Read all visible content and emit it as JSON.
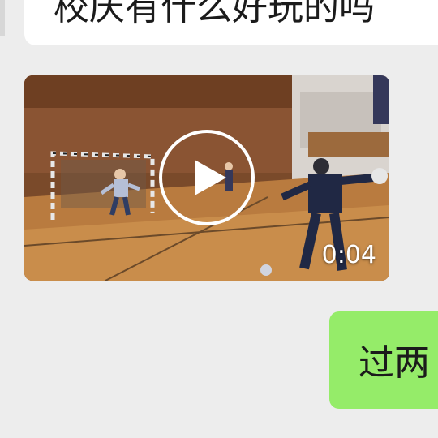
{
  "messages": {
    "incoming_text": "校庆有什么好玩的吗",
    "incoming_video": {
      "duration": "0:04",
      "icon": "play-icon"
    },
    "outgoing_text": "过两"
  },
  "colors": {
    "background": "#ededed",
    "incoming_bubble": "#ffffff",
    "outgoing_bubble": "#95ec69"
  }
}
